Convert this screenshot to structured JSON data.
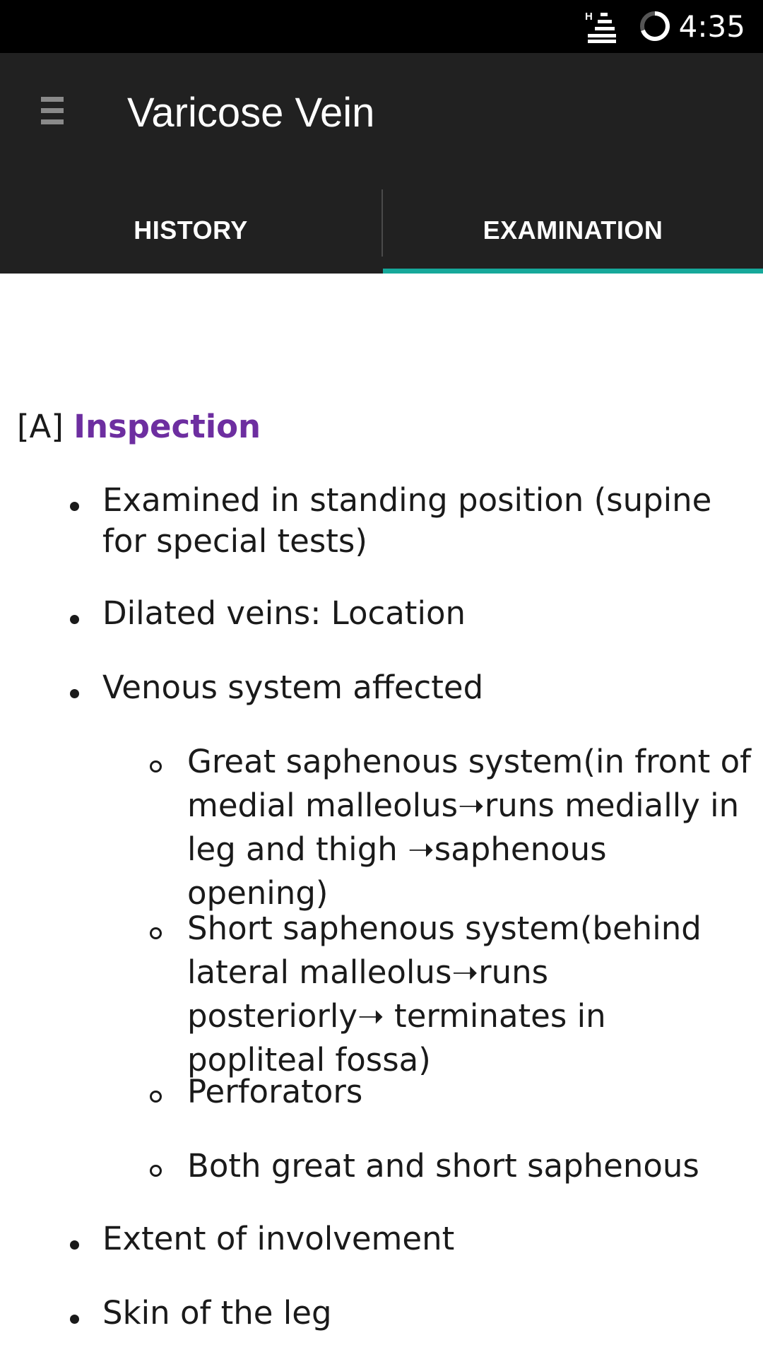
{
  "status_bar": {
    "network_icon": "h-signal-icon",
    "sync_icon": "loading-ring-icon",
    "time": "4:35"
  },
  "app_bar": {
    "menu_icon": "hamburger-menu-icon",
    "title": "Varicose Vein"
  },
  "tabs": [
    {
      "label": "HISTORY",
      "selected": false
    },
    {
      "label": "EXAMINATION",
      "selected": true
    }
  ],
  "colors": {
    "app_bar_bg": "#212121",
    "tab_indicator": "#16a89a",
    "section_title": "#6d2ea0"
  },
  "content": {
    "section": {
      "prefix": "[A]",
      "title": "Inspection"
    },
    "items": [
      {
        "level": 1,
        "text": "Examined in standing position (supine for special tests)"
      },
      {
        "level": 1,
        "text": "Dilated veins: Location"
      },
      {
        "level": 1,
        "text": "Venous system affected"
      },
      {
        "level": 2,
        "text": "Great saphenous system(in front of medial malleolus➝runs medially in leg and thigh ➝saphenous opening)"
      },
      {
        "level": 2,
        "text": "Short saphenous system(behind lateral malleolus➝runs posteriorly➝ terminates in popliteal fossa)"
      },
      {
        "level": 2,
        "text": "Perforators"
      },
      {
        "level": 2,
        "text": "Both great and short saphenous"
      },
      {
        "level": 1,
        "text": "Extent of involvement"
      },
      {
        "level": 1,
        "text": "Skin of the leg"
      }
    ]
  }
}
